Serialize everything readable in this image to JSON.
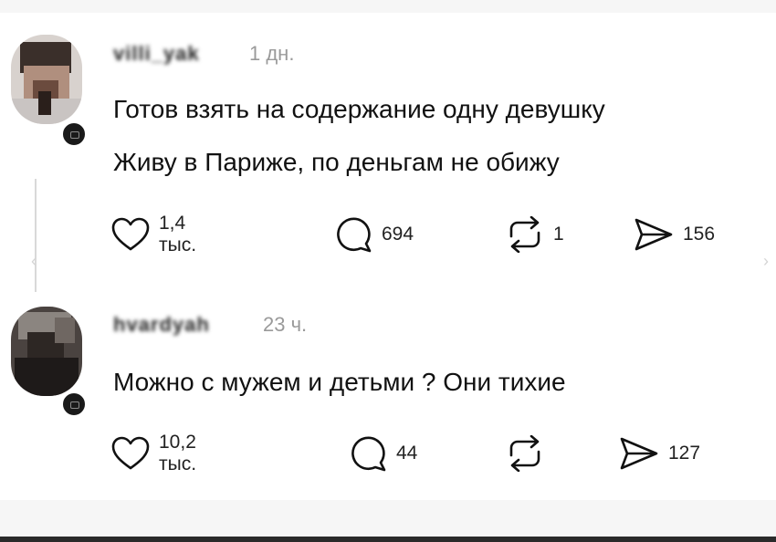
{
  "posts": [
    {
      "username": "villi_yak",
      "time": "1 дн.",
      "text_lines": [
        "Готов взять на содержание одну девушку",
        "Живу в Париже, по деньгам не обижу"
      ],
      "likes": "1,4 тыс.",
      "replies": "694",
      "reposts": "1",
      "shares": "156"
    },
    {
      "username": "hvardyah",
      "time": "23 ч.",
      "text_lines": [
        "Можно с мужем и детьми ? Они тихие"
      ],
      "likes": "10,2 тыс.",
      "replies": "44",
      "reposts": "",
      "shares": "127"
    }
  ],
  "icons": {
    "like": "heart-icon",
    "reply": "comment-bubble-icon",
    "repost": "repost-icon",
    "share": "send-icon",
    "badge": "follow-badge-icon"
  },
  "colors": {
    "text": "#111111",
    "muted": "#9a9a9a",
    "background": "#ffffff",
    "band": "#f6f6f6"
  }
}
